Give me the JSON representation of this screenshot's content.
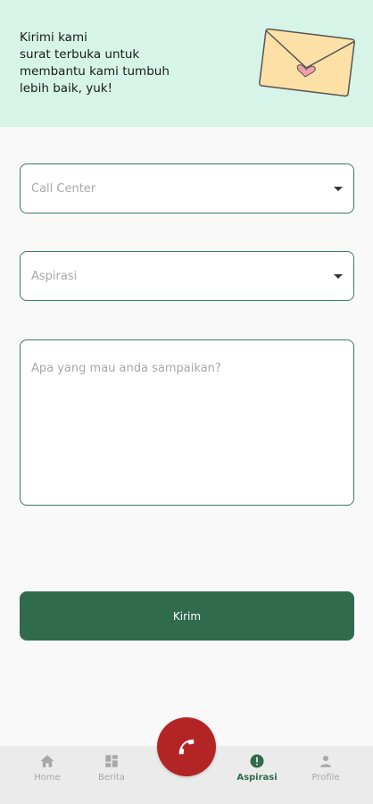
{
  "header": {
    "lines": [
      "Kirimi kami",
      "surat terbuka untuk",
      "membantu kami tumbuh",
      "lebih baik, yuk!"
    ],
    "illustration": "envelope-heart-icon"
  },
  "form": {
    "category_placeholder": "Call Center",
    "type_placeholder": "Aspirasi",
    "message_placeholder": "Apa yang mau anda sampaikan?",
    "submit_label": "Kirim"
  },
  "nav": {
    "items": [
      {
        "label": "Home",
        "icon": "home-icon",
        "active": false
      },
      {
        "label": "Berita",
        "icon": "grid-icon",
        "active": false
      },
      {
        "label": "Aspirasi",
        "icon": "alert-circle-icon",
        "active": true
      },
      {
        "label": "Profile",
        "icon": "person-icon",
        "active": false
      }
    ],
    "center_button_icon": "phone-icon"
  },
  "colors": {
    "header_bg": "#d6f5e8",
    "accent": "#2f6b4c",
    "call_button": "#b32525"
  }
}
